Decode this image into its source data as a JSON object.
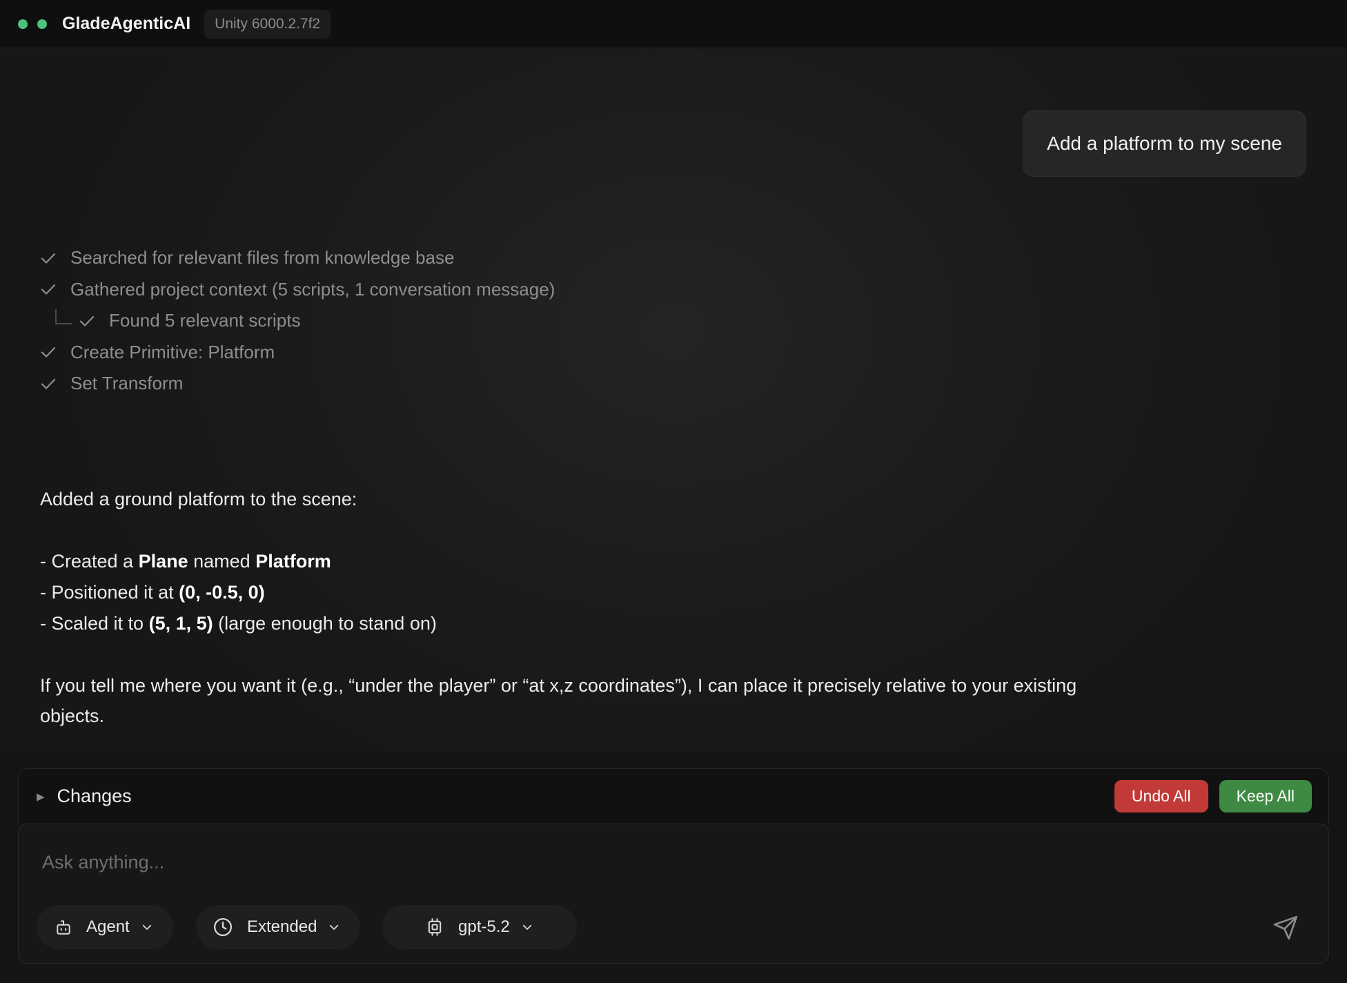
{
  "header": {
    "app_title": "GladeAgenticAI",
    "version": "Unity 6000.2.7f2",
    "status_color": "#4cc37a"
  },
  "conversation": {
    "user_message": "Add a platform to my scene",
    "steps": [
      {
        "label": "Searched for relevant files from knowledge base",
        "icon": "check-icon"
      },
      {
        "label": "Gathered project context (5 scripts, 1 conversation message)",
        "icon": "check-icon"
      },
      {
        "label": "Found 5 relevant scripts",
        "icon": "check-icon",
        "nested": true
      },
      {
        "label": "Create Primitive: Platform",
        "icon": "check-icon"
      },
      {
        "label": "Set Transform",
        "icon": "check-icon"
      }
    ],
    "answer": {
      "intro": "Added a ground platform to the scene:",
      "line1": {
        "a": "- Created a ",
        "b": "Plane",
        "c": " named ",
        "d": "Platform"
      },
      "line2": {
        "a": "- Positioned it at ",
        "b": "(0, -0.5, 0)"
      },
      "line3": {
        "a": "- Scaled it to ",
        "b": "(5, 1, 5)",
        "c": " (large enough to stand on)"
      },
      "closing": "If you tell me where you want it (e.g., “under the player” or “at x,z coordinates”), I can place it precisely relative to your existing objects."
    }
  },
  "changes": {
    "label": "Changes",
    "undo_label": "Undo All",
    "keep_label": "Keep All",
    "undo_color": "#c23a38",
    "keep_color": "#3e8a42"
  },
  "composer": {
    "placeholder": "Ask anything...",
    "value": "",
    "mode": "Agent",
    "mode_icon": "robot-icon",
    "effort": "Extended",
    "effort_icon": "clock-icon",
    "model": "gpt-5.2",
    "model_icon": "chip-icon",
    "send_icon": "send-icon"
  }
}
